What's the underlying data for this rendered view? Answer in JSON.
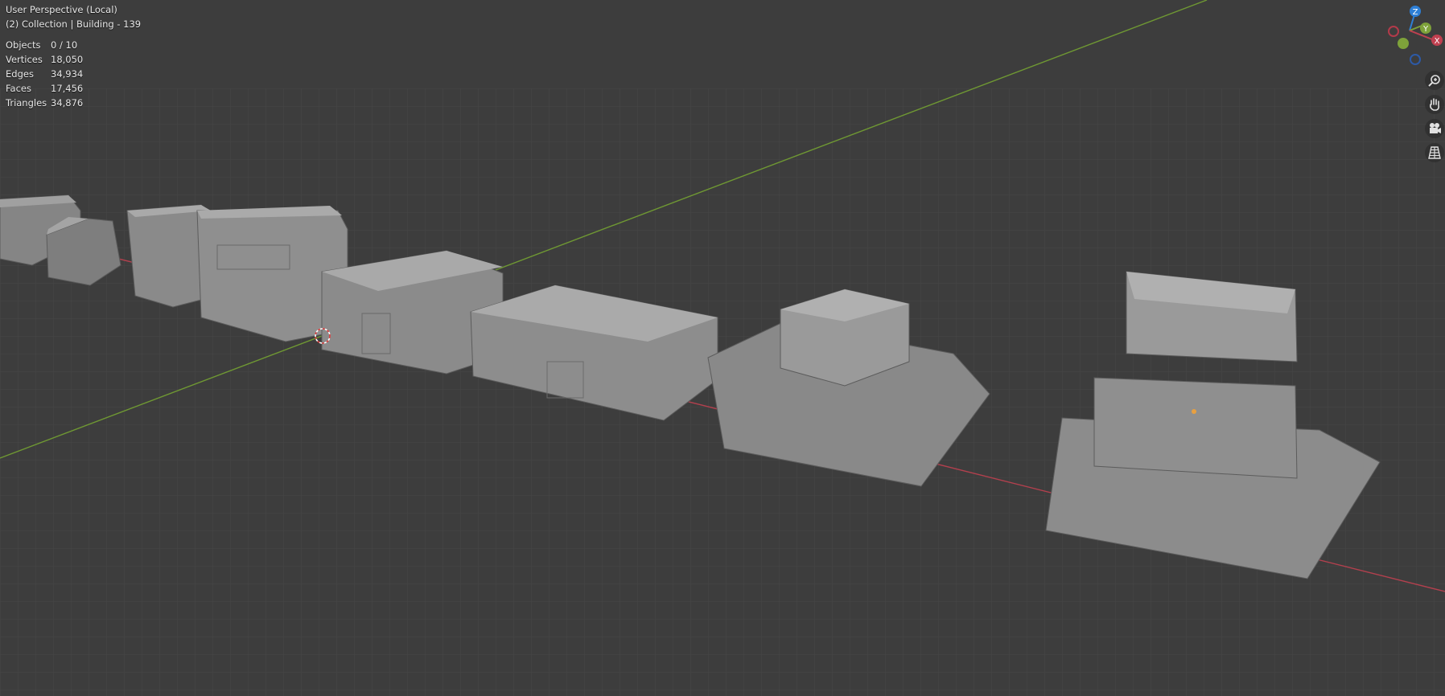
{
  "viewport": {
    "view_label": "User Perspective (Local)",
    "collection_label": "(2) Collection | Building - 139"
  },
  "stats": [
    {
      "label": "Objects",
      "value": "0 / 10"
    },
    {
      "label": "Vertices",
      "value": "18,050"
    },
    {
      "label": "Edges",
      "value": "34,934"
    },
    {
      "label": "Faces",
      "value": "17,456"
    },
    {
      "label": "Triangles",
      "value": "34,876"
    }
  ],
  "gizmo": {
    "z": "Z",
    "y": "Y",
    "x": "X"
  },
  "nav_icons": [
    "zoom-icon",
    "pan-hand-icon",
    "camera-icon",
    "grid-icon"
  ],
  "colors": {
    "background": "#3d3d3d",
    "grid": "#4a4a4a",
    "x_axis": "#c04050",
    "y_axis": "#7ea23a",
    "z_axis": "#2d7fd6",
    "mesh": "#8c8c8c"
  }
}
